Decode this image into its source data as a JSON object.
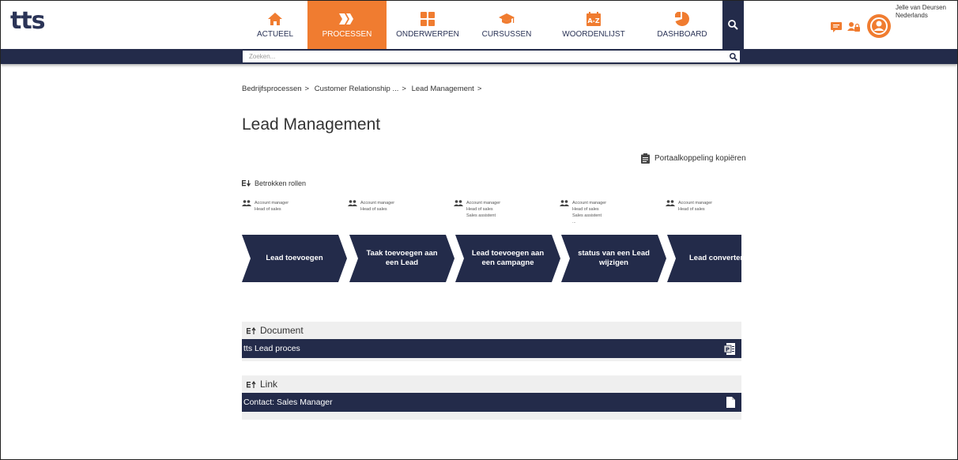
{
  "app": {
    "logo": "tts"
  },
  "nav": [
    {
      "label": "ACTUEEL",
      "icon": "home-icon",
      "active": false
    },
    {
      "label": "PROCESSEN",
      "icon": "processes-icon",
      "active": true
    },
    {
      "label": "ONDERWERPEN",
      "icon": "topics-icon",
      "active": false
    },
    {
      "label": "CURSUSSEN",
      "icon": "graduation-cap-icon",
      "active": false
    },
    {
      "label": "WOORDENLIJST",
      "icon": "glossary-icon",
      "active": false
    },
    {
      "label": "DASHBOARD",
      "icon": "pie-chart-icon",
      "active": false
    }
  ],
  "user": {
    "name": "Jelle van Deursen",
    "language": "Nederlands"
  },
  "search": {
    "placeholder": "Zoeken..."
  },
  "breadcrumb": [
    "Bedrijfsprocessen",
    "Customer Relationship ...",
    "Lead Management"
  ],
  "page": {
    "title": "Lead Management",
    "portal_link": "Portaalkoppeling kopiëren",
    "roles_toggle": "Betrokken rollen"
  },
  "roles": [
    [
      "Account manager",
      "Head of sales"
    ],
    [
      "Account manager",
      "Head of sales"
    ],
    [
      "Account manager",
      "Head of sales",
      "Sales assistent"
    ],
    [
      "Account manager",
      "Head of sales",
      "Sales assistent",
      "..."
    ],
    [
      "Account manager",
      "Head of sales"
    ]
  ],
  "steps": [
    {
      "line1": "Lead toevoegen",
      "line2": ""
    },
    {
      "line1": "Taak toevoegen aan",
      "line2": "een Lead"
    },
    {
      "line1": "Lead toevoegen aan",
      "line2": "een campagne"
    },
    {
      "line1": "status van een Lead",
      "line2": "wijzigen"
    },
    {
      "line1": "Lead converteren",
      "line2": ""
    }
  ],
  "document_section": {
    "heading": "Document",
    "item": "tts Lead proces"
  },
  "link_section": {
    "heading": "Link",
    "item": "Contact: Sales Manager"
  },
  "colors": {
    "navy": "#232b4a",
    "orange": "#f07c30"
  }
}
